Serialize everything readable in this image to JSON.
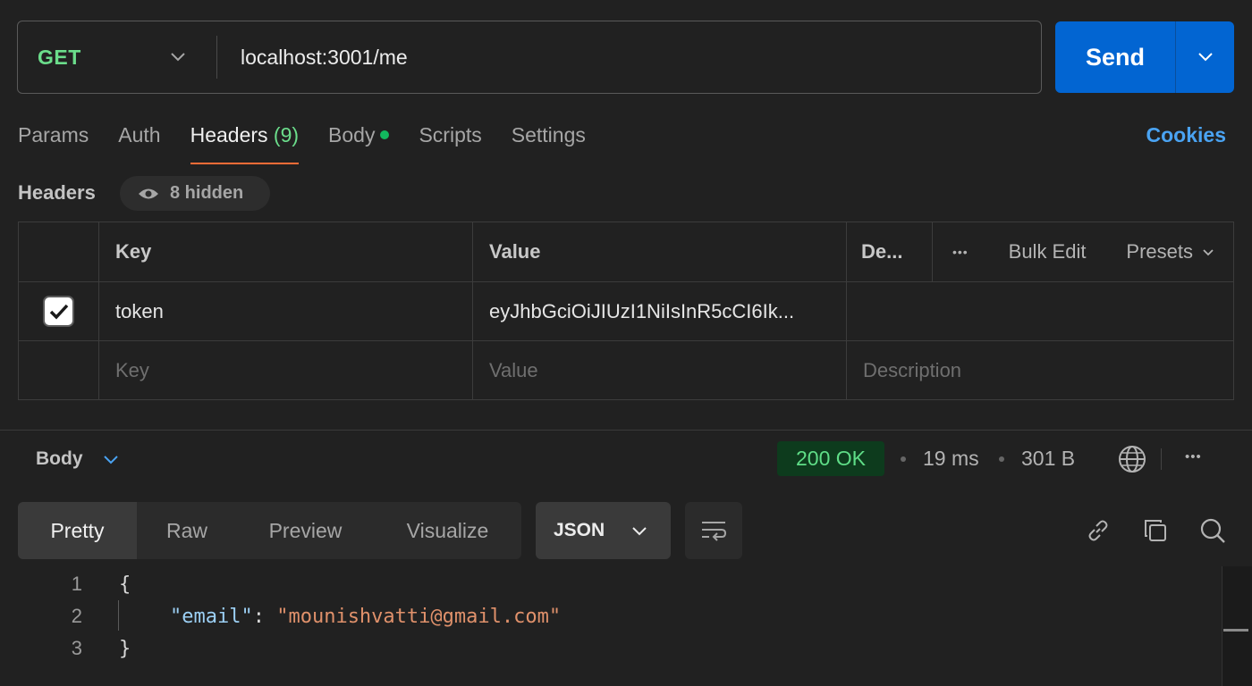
{
  "request": {
    "method": "GET",
    "url": "localhost:3001/me",
    "send_label": "Send"
  },
  "tabs": [
    {
      "label": "Params"
    },
    {
      "label": "Auth"
    },
    {
      "label": "Headers",
      "count": "(9)"
    },
    {
      "label": "Body"
    },
    {
      "label": "Scripts"
    },
    {
      "label": "Settings"
    }
  ],
  "cookies_label": "Cookies",
  "headers": {
    "title": "Headers",
    "hidden_label": "8 hidden",
    "columns": {
      "key": "Key",
      "value": "Value",
      "description": "De...",
      "more": "•••",
      "bulk_edit": "Bulk Edit",
      "presets": "Presets"
    },
    "rows": [
      {
        "enabled": true,
        "key": "token",
        "value": "eyJhbGciOiJIUzI1NiIsInR5cCI6Ik..."
      }
    ],
    "placeholders": {
      "key": "Key",
      "value": "Value",
      "description": "Description"
    }
  },
  "response": {
    "body_label": "Body",
    "status": "200 OK",
    "time": "19 ms",
    "size": "301 B",
    "more": "•••",
    "view_tabs": [
      "Pretty",
      "Raw",
      "Preview",
      "Visualize"
    ],
    "active_view": "Pretty",
    "format": "JSON",
    "lines": [
      {
        "num": "1",
        "text": "{"
      },
      {
        "num": "2",
        "key": "\"email\"",
        "colon": ": ",
        "value": "\"mounishvatti@gmail.com\""
      },
      {
        "num": "3",
        "text": "}"
      }
    ]
  },
  "colors": {
    "accent_orange": "#ff6c37",
    "send_blue": "#0265d2",
    "method_green": "#6bdd8b",
    "status_green": "#5fdd87",
    "link_blue": "#4aa3f2"
  },
  "icons": [
    "chevron-down-icon",
    "eye-icon",
    "check-icon",
    "globe-icon",
    "wrap-icon",
    "link-icon",
    "copy-icon",
    "search-icon"
  ]
}
